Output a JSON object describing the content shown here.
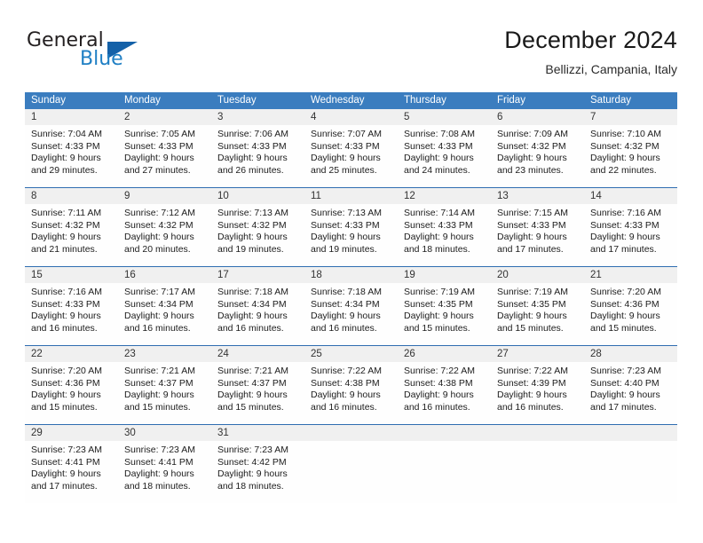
{
  "brand": {
    "name_part1": "General",
    "name_part2": "Blue",
    "triangle_color": "#1461a8",
    "blue_color": "#1f7fc4"
  },
  "header": {
    "title": "December 2024",
    "subtitle": "Bellizzi, Campania, Italy"
  },
  "theme": {
    "header_bg": "#3b7dbf",
    "header_text": "#ffffff",
    "daynum_bg": "#f0f0f0",
    "row_divider": "#2f6db1"
  },
  "weekdays": [
    "Sunday",
    "Monday",
    "Tuesday",
    "Wednesday",
    "Thursday",
    "Friday",
    "Saturday"
  ],
  "weeks": [
    [
      {
        "day": "1",
        "sunrise": "Sunrise: 7:04 AM",
        "sunset": "Sunset: 4:33 PM",
        "daylight1": "Daylight: 9 hours",
        "daylight2": "and 29 minutes."
      },
      {
        "day": "2",
        "sunrise": "Sunrise: 7:05 AM",
        "sunset": "Sunset: 4:33 PM",
        "daylight1": "Daylight: 9 hours",
        "daylight2": "and 27 minutes."
      },
      {
        "day": "3",
        "sunrise": "Sunrise: 7:06 AM",
        "sunset": "Sunset: 4:33 PM",
        "daylight1": "Daylight: 9 hours",
        "daylight2": "and 26 minutes."
      },
      {
        "day": "4",
        "sunrise": "Sunrise: 7:07 AM",
        "sunset": "Sunset: 4:33 PM",
        "daylight1": "Daylight: 9 hours",
        "daylight2": "and 25 minutes."
      },
      {
        "day": "5",
        "sunrise": "Sunrise: 7:08 AM",
        "sunset": "Sunset: 4:33 PM",
        "daylight1": "Daylight: 9 hours",
        "daylight2": "and 24 minutes."
      },
      {
        "day": "6",
        "sunrise": "Sunrise: 7:09 AM",
        "sunset": "Sunset: 4:32 PM",
        "daylight1": "Daylight: 9 hours",
        "daylight2": "and 23 minutes."
      },
      {
        "day": "7",
        "sunrise": "Sunrise: 7:10 AM",
        "sunset": "Sunset: 4:32 PM",
        "daylight1": "Daylight: 9 hours",
        "daylight2": "and 22 minutes."
      }
    ],
    [
      {
        "day": "8",
        "sunrise": "Sunrise: 7:11 AM",
        "sunset": "Sunset: 4:32 PM",
        "daylight1": "Daylight: 9 hours",
        "daylight2": "and 21 minutes."
      },
      {
        "day": "9",
        "sunrise": "Sunrise: 7:12 AM",
        "sunset": "Sunset: 4:32 PM",
        "daylight1": "Daylight: 9 hours",
        "daylight2": "and 20 minutes."
      },
      {
        "day": "10",
        "sunrise": "Sunrise: 7:13 AM",
        "sunset": "Sunset: 4:32 PM",
        "daylight1": "Daylight: 9 hours",
        "daylight2": "and 19 minutes."
      },
      {
        "day": "11",
        "sunrise": "Sunrise: 7:13 AM",
        "sunset": "Sunset: 4:33 PM",
        "daylight1": "Daylight: 9 hours",
        "daylight2": "and 19 minutes."
      },
      {
        "day": "12",
        "sunrise": "Sunrise: 7:14 AM",
        "sunset": "Sunset: 4:33 PM",
        "daylight1": "Daylight: 9 hours",
        "daylight2": "and 18 minutes."
      },
      {
        "day": "13",
        "sunrise": "Sunrise: 7:15 AM",
        "sunset": "Sunset: 4:33 PM",
        "daylight1": "Daylight: 9 hours",
        "daylight2": "and 17 minutes."
      },
      {
        "day": "14",
        "sunrise": "Sunrise: 7:16 AM",
        "sunset": "Sunset: 4:33 PM",
        "daylight1": "Daylight: 9 hours",
        "daylight2": "and 17 minutes."
      }
    ],
    [
      {
        "day": "15",
        "sunrise": "Sunrise: 7:16 AM",
        "sunset": "Sunset: 4:33 PM",
        "daylight1": "Daylight: 9 hours",
        "daylight2": "and 16 minutes."
      },
      {
        "day": "16",
        "sunrise": "Sunrise: 7:17 AM",
        "sunset": "Sunset: 4:34 PM",
        "daylight1": "Daylight: 9 hours",
        "daylight2": "and 16 minutes."
      },
      {
        "day": "17",
        "sunrise": "Sunrise: 7:18 AM",
        "sunset": "Sunset: 4:34 PM",
        "daylight1": "Daylight: 9 hours",
        "daylight2": "and 16 minutes."
      },
      {
        "day": "18",
        "sunrise": "Sunrise: 7:18 AM",
        "sunset": "Sunset: 4:34 PM",
        "daylight1": "Daylight: 9 hours",
        "daylight2": "and 16 minutes."
      },
      {
        "day": "19",
        "sunrise": "Sunrise: 7:19 AM",
        "sunset": "Sunset: 4:35 PM",
        "daylight1": "Daylight: 9 hours",
        "daylight2": "and 15 minutes."
      },
      {
        "day": "20",
        "sunrise": "Sunrise: 7:19 AM",
        "sunset": "Sunset: 4:35 PM",
        "daylight1": "Daylight: 9 hours",
        "daylight2": "and 15 minutes."
      },
      {
        "day": "21",
        "sunrise": "Sunrise: 7:20 AM",
        "sunset": "Sunset: 4:36 PM",
        "daylight1": "Daylight: 9 hours",
        "daylight2": "and 15 minutes."
      }
    ],
    [
      {
        "day": "22",
        "sunrise": "Sunrise: 7:20 AM",
        "sunset": "Sunset: 4:36 PM",
        "daylight1": "Daylight: 9 hours",
        "daylight2": "and 15 minutes."
      },
      {
        "day": "23",
        "sunrise": "Sunrise: 7:21 AM",
        "sunset": "Sunset: 4:37 PM",
        "daylight1": "Daylight: 9 hours",
        "daylight2": "and 15 minutes."
      },
      {
        "day": "24",
        "sunrise": "Sunrise: 7:21 AM",
        "sunset": "Sunset: 4:37 PM",
        "daylight1": "Daylight: 9 hours",
        "daylight2": "and 15 minutes."
      },
      {
        "day": "25",
        "sunrise": "Sunrise: 7:22 AM",
        "sunset": "Sunset: 4:38 PM",
        "daylight1": "Daylight: 9 hours",
        "daylight2": "and 16 minutes."
      },
      {
        "day": "26",
        "sunrise": "Sunrise: 7:22 AM",
        "sunset": "Sunset: 4:38 PM",
        "daylight1": "Daylight: 9 hours",
        "daylight2": "and 16 minutes."
      },
      {
        "day": "27",
        "sunrise": "Sunrise: 7:22 AM",
        "sunset": "Sunset: 4:39 PM",
        "daylight1": "Daylight: 9 hours",
        "daylight2": "and 16 minutes."
      },
      {
        "day": "28",
        "sunrise": "Sunrise: 7:23 AM",
        "sunset": "Sunset: 4:40 PM",
        "daylight1": "Daylight: 9 hours",
        "daylight2": "and 17 minutes."
      }
    ],
    [
      {
        "day": "29",
        "sunrise": "Sunrise: 7:23 AM",
        "sunset": "Sunset: 4:41 PM",
        "daylight1": "Daylight: 9 hours",
        "daylight2": "and 17 minutes."
      },
      {
        "day": "30",
        "sunrise": "Sunrise: 7:23 AM",
        "sunset": "Sunset: 4:41 PM",
        "daylight1": "Daylight: 9 hours",
        "daylight2": "and 18 minutes."
      },
      {
        "day": "31",
        "sunrise": "Sunrise: 7:23 AM",
        "sunset": "Sunset: 4:42 PM",
        "daylight1": "Daylight: 9 hours",
        "daylight2": "and 18 minutes."
      },
      {
        "day": "",
        "sunrise": "",
        "sunset": "",
        "daylight1": "",
        "daylight2": ""
      },
      {
        "day": "",
        "sunrise": "",
        "sunset": "",
        "daylight1": "",
        "daylight2": ""
      },
      {
        "day": "",
        "sunrise": "",
        "sunset": "",
        "daylight1": "",
        "daylight2": ""
      },
      {
        "day": "",
        "sunrise": "",
        "sunset": "",
        "daylight1": "",
        "daylight2": ""
      }
    ]
  ]
}
